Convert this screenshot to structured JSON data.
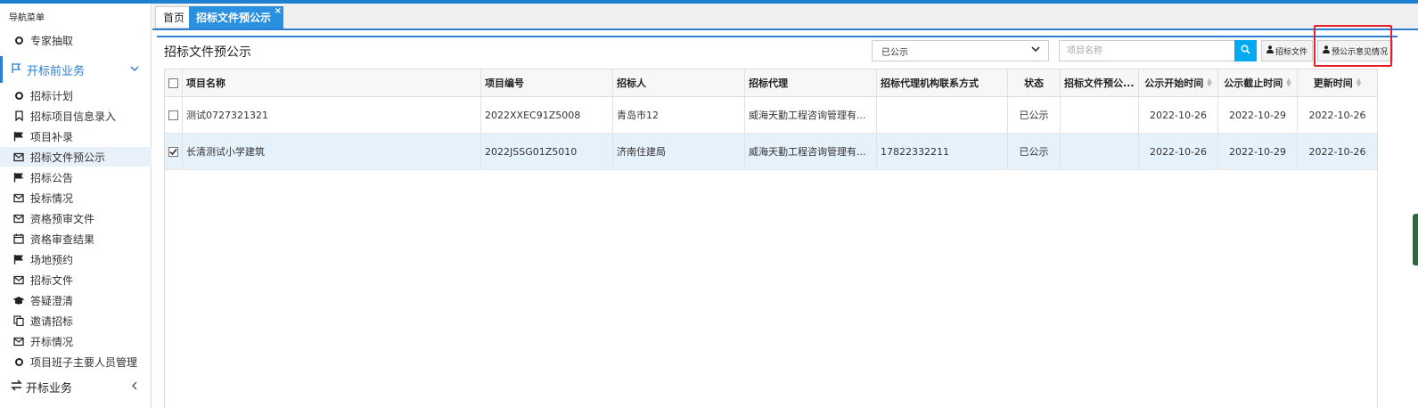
{
  "sidebar": {
    "title": "导航菜单",
    "top_item": "专家抽取",
    "group_open": "开标前业务",
    "items": [
      {
        "label": "招标计划",
        "icon": "circle-icon"
      },
      {
        "label": "招标项目信息录入",
        "icon": "bookmark-icon"
      },
      {
        "label": "项目补录",
        "icon": "flag-icon"
      },
      {
        "label": "招标文件预公示",
        "icon": "envelope-icon",
        "active": true
      },
      {
        "label": "招标公告",
        "icon": "flag-icon"
      },
      {
        "label": "投标情况",
        "icon": "envelope-icon"
      },
      {
        "label": "资格预审文件",
        "icon": "envelope-icon"
      },
      {
        "label": "资格审查结果",
        "icon": "calendar-icon"
      },
      {
        "label": "场地预约",
        "icon": "flag-icon"
      },
      {
        "label": "招标文件",
        "icon": "envelope-icon"
      },
      {
        "label": "答疑澄清",
        "icon": "graduation-cap-icon"
      },
      {
        "label": "邀请招标",
        "icon": "copy-icon"
      },
      {
        "label": "开标情况",
        "icon": "envelope-icon"
      },
      {
        "label": "项目班子主要人员管理",
        "icon": "circle-icon"
      }
    ],
    "group_closed": "开标业务"
  },
  "tabs": {
    "home": "首页",
    "active": "招标文件预公示",
    "close_glyph": "×"
  },
  "panel": {
    "title": "招标文件预公示",
    "status_select": "已公示",
    "search_placeholder": "项目名称",
    "btn_file": "招标文件",
    "btn_opinion": "预公示意见情况"
  },
  "table": {
    "columns": [
      "项目名称",
      "项目编号",
      "招标人",
      "招标代理",
      "招标代理机构联系方式",
      "状态",
      "招标文件预公...",
      "公示开始时间",
      "公示截止时间",
      "更新时间"
    ],
    "rows": [
      {
        "checked": false,
        "name": "测试0727321321",
        "code": "2022XXEC91Z5008",
        "tenderer": "青岛市12",
        "agent": "威海天勤工程咨询管理有...",
        "contact": "",
        "status": "已公示",
        "pre": "",
        "start": "2022-10-26",
        "end": "2022-10-29",
        "updated": "2022-10-26"
      },
      {
        "checked": true,
        "name": "长清测试小学建筑",
        "code": "2022JSSG01Z5010",
        "tenderer": "济南住建局",
        "agent": "威海天勤工程咨询管理有...",
        "contact": "17822332211",
        "status": "已公示",
        "pre": "",
        "start": "2022-10-26",
        "end": "2022-10-29",
        "updated": "2022-10-26"
      }
    ]
  },
  "colors": {
    "accent": "#2a7fd4",
    "search": "#00aaf0",
    "highlight": "#e8202a",
    "selected_row": "#e6f2fb"
  }
}
